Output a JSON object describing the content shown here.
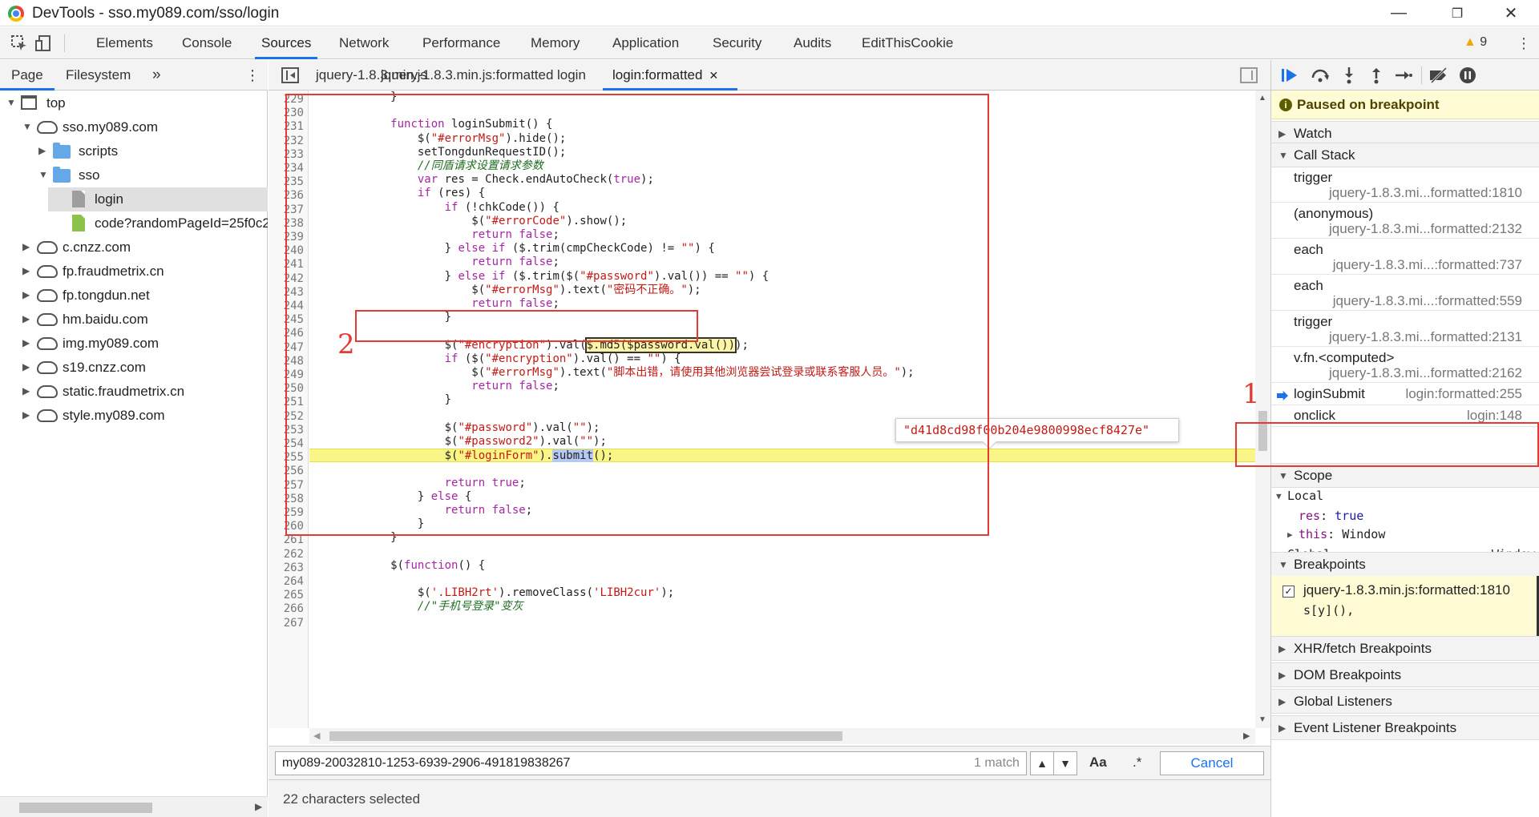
{
  "window": {
    "title": "DevTools - sso.my089.com/sso/login",
    "minimize": "—",
    "restore": "❐",
    "close": "✕"
  },
  "toolbar": {
    "tabs": [
      "Elements",
      "Console",
      "Sources",
      "Network",
      "Performance",
      "Memory",
      "Application",
      "Security",
      "Audits",
      "EditThisCookie"
    ],
    "active_tab": "Sources",
    "warnings": "9"
  },
  "navigator": {
    "tabs": [
      "Page",
      "Filesystem"
    ],
    "more": "»",
    "tree": [
      {
        "label": "top",
        "type": "frame",
        "depth": 0,
        "open": true
      },
      {
        "label": "sso.my089.com",
        "type": "cloud",
        "depth": 1,
        "open": true
      },
      {
        "label": "scripts",
        "type": "folder",
        "depth": 2,
        "open": false
      },
      {
        "label": "sso",
        "type": "folder",
        "depth": 2,
        "open": true
      },
      {
        "label": "login",
        "type": "file",
        "depth": 3,
        "selected": true
      },
      {
        "label": "code?randomPageId=25f0c2",
        "type": "file-green",
        "depth": 3
      },
      {
        "label": "c.cnzz.com",
        "type": "cloud",
        "depth": 1,
        "open": false
      },
      {
        "label": "fp.fraudmetrix.cn",
        "type": "cloud",
        "depth": 1,
        "open": false
      },
      {
        "label": "fp.tongdun.net",
        "type": "cloud",
        "depth": 1,
        "open": false
      },
      {
        "label": "hm.baidu.com",
        "type": "cloud",
        "depth": 1,
        "open": false
      },
      {
        "label": "img.my089.com",
        "type": "cloud",
        "depth": 1,
        "open": false
      },
      {
        "label": "s19.cnzz.com",
        "type": "cloud",
        "depth": 1,
        "open": false
      },
      {
        "label": "static.fraudmetrix.cn",
        "type": "cloud",
        "depth": 1,
        "open": false
      },
      {
        "label": "style.my089.com",
        "type": "cloud",
        "depth": 1,
        "open": false
      }
    ]
  },
  "editor": {
    "tabs": [
      "jquery-1.8.3.min.js",
      "jquery-1.8.3.min.js:formatted",
      "login",
      "login:formatted"
    ],
    "active_tab": "login:formatted",
    "close_glyph": "✕",
    "first_line": 229,
    "exec_line": 255,
    "lines": [
      "            }",
      "",
      "            function loginSubmit() {",
      "                $(\"#errorMsg\").hide();",
      "                setTongdunRequestID();",
      "                //同盾请求设置请求参数",
      "                var res = Check.endAutoCheck(true);",
      "                if (res) {",
      "                    if (!chkCode()) {",
      "                        $(\"#errorCode\").show();",
      "                        return false;",
      "                    } else if ($.trim(cmpCheckCode) != \"\") {",
      "                        return false;",
      "                    } else if ($.trim($(\"#password\").val()) == \"\") {",
      "                        $(\"#errorMsg\").text(\"密码不正确。\");",
      "                        return false;",
      "                    }",
      "",
      "                    $(\"#encryption\").val($.md5($password.val()));",
      "                    if ($(\"#encryption\").val() == \"\") {",
      "                        $(\"#errorMsg\").text(\"脚本出错，请使用其他浏览器尝试登录或联系客服人员。\");",
      "                        return false;",
      "                    }",
      "",
      "                    $(\"#password\").val(\"\");",
      "                    $(\"#password2\").val(\"\");",
      "                    $(\"#loginForm\").submit();",
      "",
      "                    return true;",
      "                } else {",
      "                    return false;",
      "                }",
      "            }",
      "",
      "            $(function() {",
      "",
      "                $('.LIBH2rt').removeClass('LIBH2cur');",
      "                //\"手机号登录\"变灰",
      "                "
    ],
    "tooltip": "\"d41d8cd98f00b204e9800998ecf8427e\"",
    "annotations": [
      "2",
      "1"
    ]
  },
  "search": {
    "value": "my089-20032810-1253-6939-2906-491819838267",
    "match_count": "1 match",
    "case_label": "Aa",
    "regex_label": ".*",
    "cancel_label": "Cancel"
  },
  "status": {
    "text": "22 characters selected"
  },
  "debugger": {
    "paused_text": "Paused on breakpoint",
    "sections": {
      "watch": "Watch",
      "call_stack": "Call Stack",
      "scope": "Scope",
      "breakpoints": "Breakpoints",
      "xhr": "XHR/fetch Breakpoints",
      "dom": "DOM Breakpoints",
      "global_listeners": "Global Listeners",
      "event_listeners": "Event Listener Breakpoints"
    },
    "call_stack": [
      {
        "fn": "trigger",
        "loc": "jquery-1.8.3.mi...formatted:1810"
      },
      {
        "fn": "(anonymous)",
        "loc": "jquery-1.8.3.mi...formatted:2132"
      },
      {
        "fn": "each",
        "loc": "jquery-1.8.3.mi...:formatted:737"
      },
      {
        "fn": "each",
        "loc": "jquery-1.8.3.mi...:formatted:559"
      },
      {
        "fn": "trigger",
        "loc": "jquery-1.8.3.mi...formatted:2131"
      },
      {
        "fn": "v.fn.<computed>",
        "loc": "jquery-1.8.3.mi...formatted:2162"
      },
      {
        "fn": "loginSubmit",
        "loc": "login:formatted:255",
        "current": true
      },
      {
        "fn": "onclick",
        "loc": "login:148"
      }
    ],
    "scope": {
      "local_label": "Local",
      "res_key": "res",
      "res_val": "true",
      "this_key": "this",
      "this_val": "Window",
      "global_label": "Global",
      "global_val": "Window"
    },
    "breakpoint": {
      "file": "jquery-1.8.3.min.js:formatted:1810",
      "code": "s[y](),",
      "checked": true
    }
  }
}
